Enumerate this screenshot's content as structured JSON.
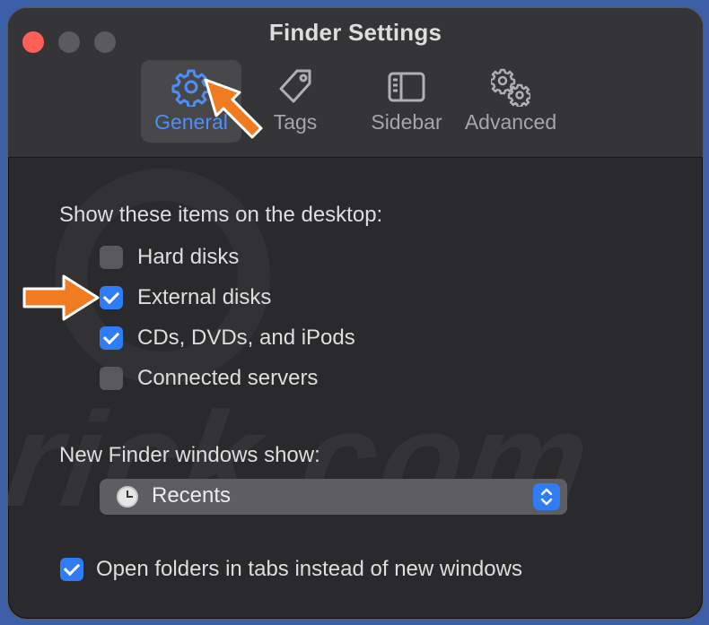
{
  "window": {
    "title": "Finder Settings"
  },
  "tabs": [
    {
      "label": "General",
      "icon": "gear-icon"
    },
    {
      "label": "Tags",
      "icon": "tag-icon"
    },
    {
      "label": "Sidebar",
      "icon": "sidebar-icon"
    },
    {
      "label": "Advanced",
      "icon": "gears-icon"
    }
  ],
  "desktop_items": {
    "heading": "Show these items on the desktop:",
    "items": [
      {
        "label": "Hard disks",
        "checked": false
      },
      {
        "label": "External disks",
        "checked": true
      },
      {
        "label": "CDs, DVDs, and iPods",
        "checked": true
      },
      {
        "label": "Connected servers",
        "checked": false
      }
    ]
  },
  "new_window": {
    "heading": "New Finder windows show:",
    "selected": "Recents",
    "icon": "clock-icon"
  },
  "open_in_tabs": {
    "label": "Open folders in tabs instead of new windows",
    "checked": true
  },
  "watermark": "rick.com",
  "colors": {
    "accent": "#2f7cf6",
    "active_tab_text": "#4d8ff5",
    "annotation_arrow": "#f07b21",
    "close_button": "#fe5f57"
  }
}
